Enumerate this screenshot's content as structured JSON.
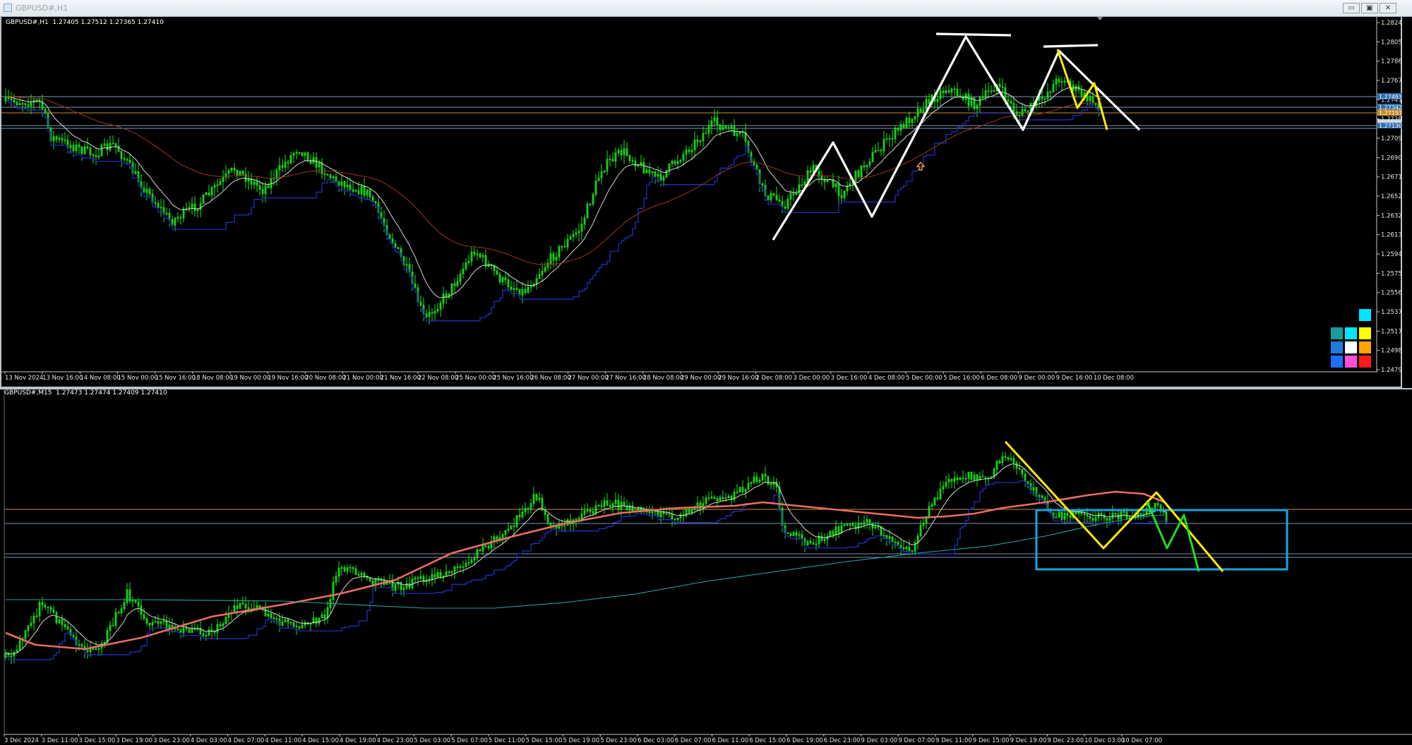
{
  "window": {
    "title": "GBPUSD#,H1",
    "buttons": {
      "minimize": "▭",
      "restore": "▣",
      "close": "✕"
    }
  },
  "pane1": {
    "label": "GBPUSD#,H1  1.27405 1.27512 1.27365 1.27410",
    "price_axis": [
      "1.28245",
      "1.28050",
      "1.27860",
      "1.27670",
      "1.27410",
      "1.27285",
      "1.27095",
      "1.26900",
      "1.26710",
      "1.26520",
      "1.26325",
      "1.26135",
      "1.25945",
      "1.25750",
      "1.25560",
      "1.25370",
      "1.25170",
      "1.24985",
      "1.24795"
    ],
    "price_badges": [
      "1.27493",
      "1.27342",
      "1.27157",
      "1.27130"
    ],
    "time_axis": [
      "13 Nov 2024",
      "13 Nov 16:00",
      "14 Nov 08:00",
      "15 Nov 00:00",
      "15 Nov 16:00",
      "18 Nov 08:00",
      "19 Nov 00:00",
      "19 Nov 16:00",
      "20 Nov 08:00",
      "21 Nov 00:00",
      "21 Nov 16:00",
      "22 Nov 08:00",
      "25 Nov 00:00",
      "25 Nov 16:00",
      "26 Nov 08:00",
      "27 Nov 00:00",
      "27 Nov 16:00",
      "28 Nov 08:00",
      "29 Nov 00:00",
      "29 Nov 16:00",
      "2 Dec 08:00",
      "3 Dec 00:00",
      "3 Dec 16:00",
      "4 Dec 08:00",
      "5 Dec 00:00",
      "5 Dec 16:00",
      "6 Dec 08:00",
      "9 Dec 00:00",
      "9 Dec 16:00",
      "10 Dec 08:00"
    ],
    "palette": [
      "#1a9a9a",
      "#00e5ff",
      "#ffff00",
      "#1e7be0",
      "#ffffff",
      "#ffa500",
      "#1e6fff",
      "#ff4fd8",
      "#ff1a1a"
    ],
    "palette_top": "#00e5ff"
  },
  "pane2": {
    "label": "GBPUSD#,M15  1.27473 1.27474 1.27409 1.27410",
    "time_axis": [
      "3 Dec 2024",
      "3 Dec 11:00",
      "3 Dec 15:00",
      "3 Dec 19:00",
      "3 Dec 23:00",
      "4 Dec 03:00",
      "4 Dec 07:00",
      "4 Dec 11:00",
      "4 Dec 15:00",
      "4 Dec 19:00",
      "4 Dec 23:00",
      "5 Dec 03:00",
      "5 Dec 07:00",
      "5 Dec 11:00",
      "5 Dec 15:00",
      "5 Dec 19:00",
      "5 Dec 23:00",
      "6 Dec 03:00",
      "6 Dec 07:00",
      "6 Dec 11:00",
      "6 Dec 15:00",
      "6 Dec 19:00",
      "6 Dec 23:00",
      "9 Dec 03:00",
      "9 Dec 07:00",
      "9 Dec 11:00",
      "9 Dec 15:00",
      "9 Dec 19:00",
      "9 Dec 23:00",
      "10 Dec 03:00",
      "10 Dec 07:00"
    ]
  },
  "colors": {
    "candle": "#19e619",
    "ma_white": "#d8d8d8",
    "ma_blue": "#2233cc",
    "ma_brown": "#a0341e",
    "ma_salmon": "#ea6d62",
    "ma_teal": "#1fa6a0",
    "zigzag_white": "#ffffff",
    "zigzag_yellow": "#ffec00",
    "zigzag_green": "#22dd22",
    "box": "#1aa3e0",
    "level_line": "#7f95b8",
    "level_orange": "#c8903a"
  }
}
